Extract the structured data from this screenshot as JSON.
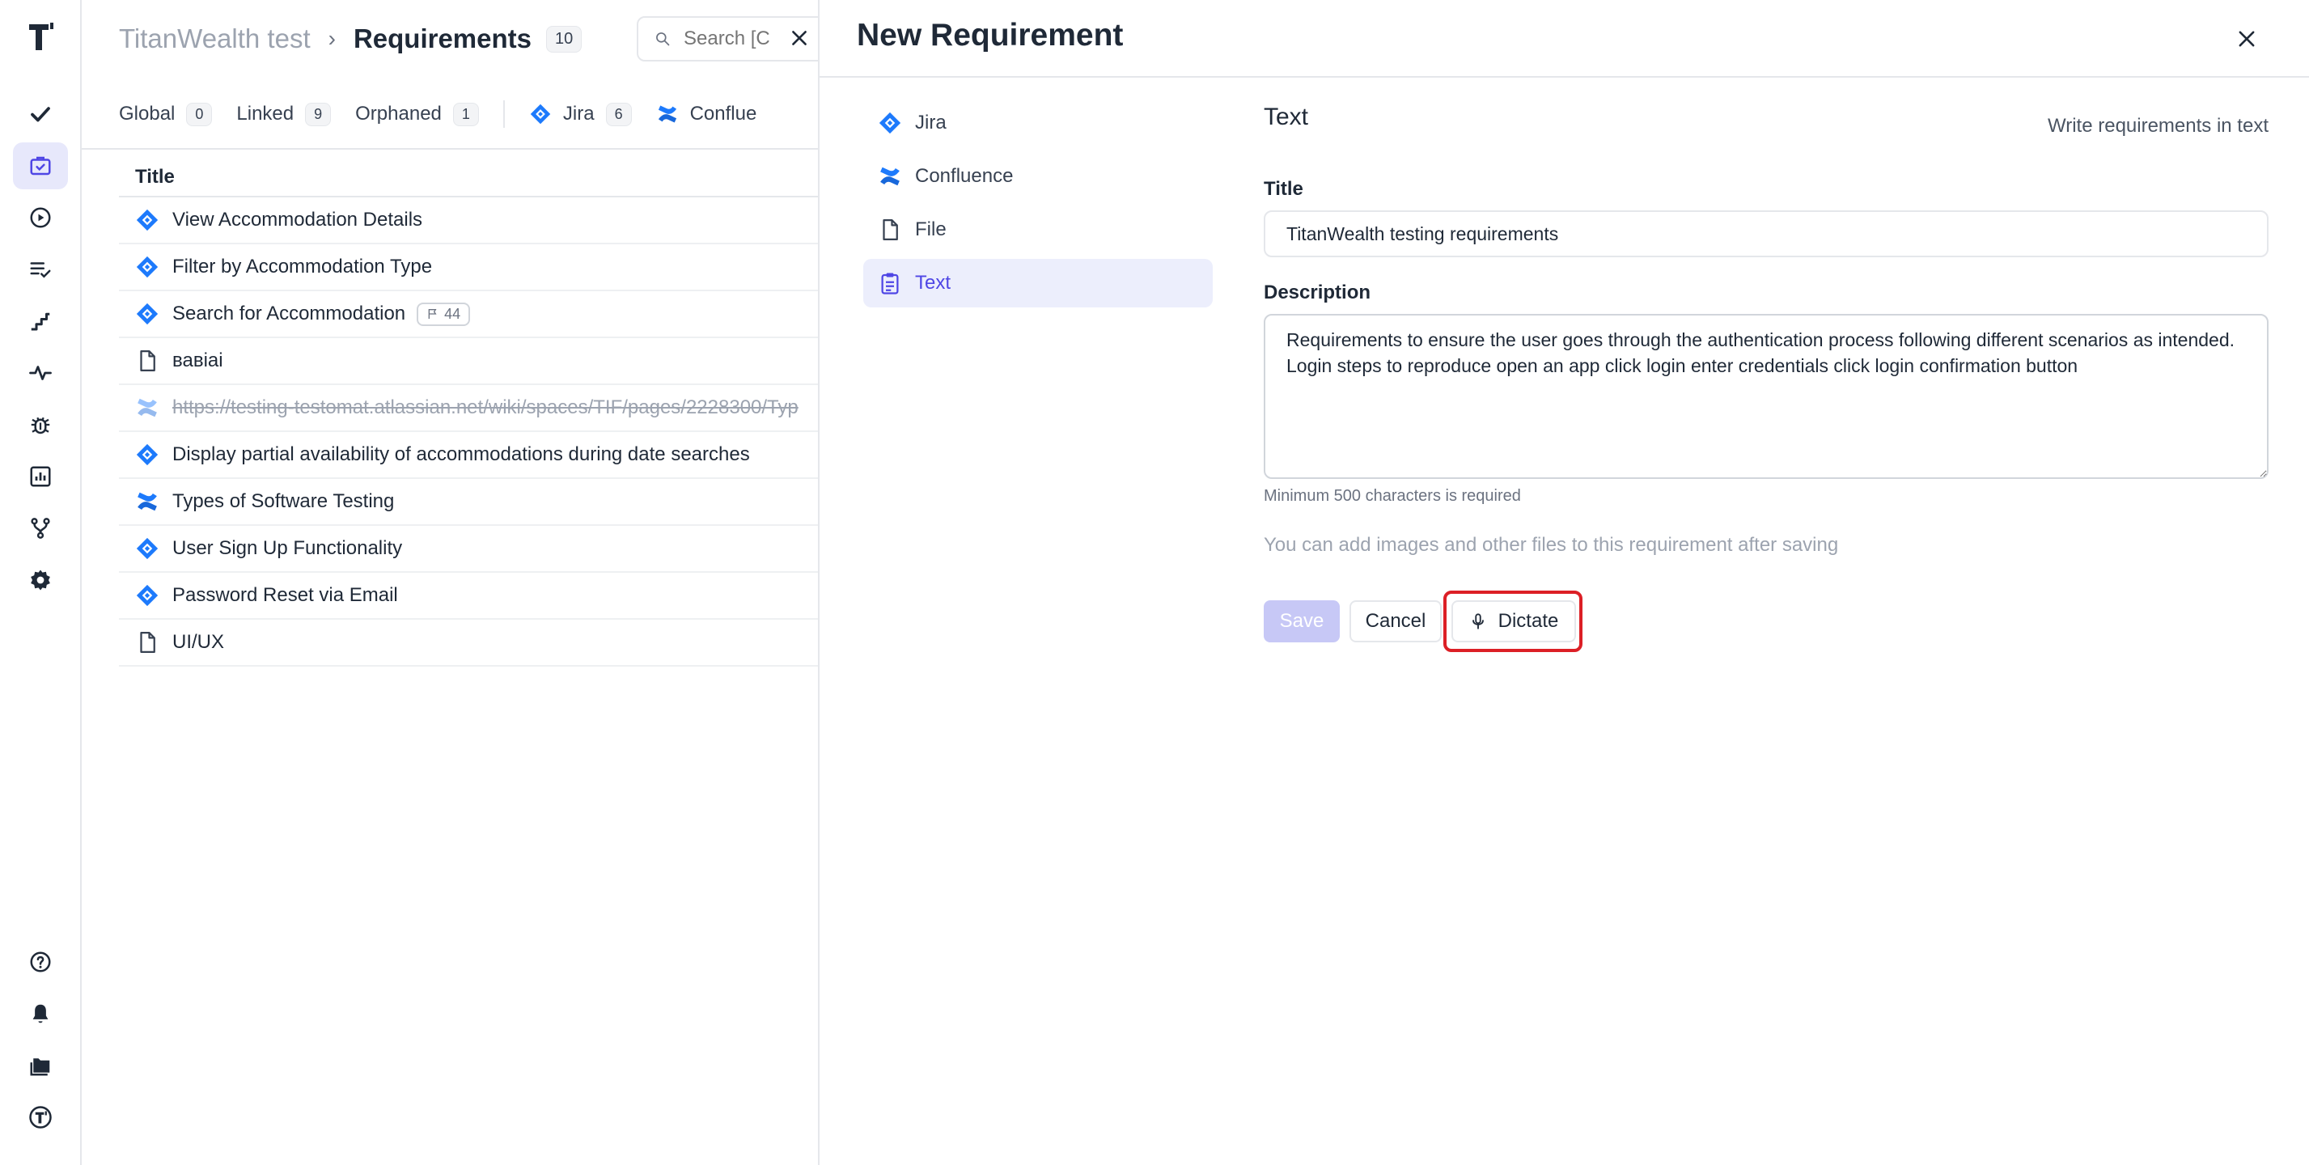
{
  "breadcrumb": {
    "project": "TitanWealth test",
    "separator": "›",
    "page": "Requirements",
    "count": "10"
  },
  "search": {
    "placeholder": "Search [C"
  },
  "filters": [
    {
      "label": "Global",
      "count": "0"
    },
    {
      "label": "Linked",
      "count": "9"
    },
    {
      "label": "Orphaned",
      "count": "1"
    },
    {
      "label": "Jira",
      "count": "6",
      "icon": "jira-icon"
    },
    {
      "label": "Conflue",
      "icon": "confluence-icon"
    }
  ],
  "list": {
    "column_title": "Title",
    "rows": [
      {
        "title": "View Accommodation Details",
        "icon": "jira-icon"
      },
      {
        "title": "Filter by Accommodation Type",
        "icon": "jira-icon"
      },
      {
        "title": "Search for Accommodation",
        "icon": "jira-icon",
        "badge": "44"
      },
      {
        "title": "вавіаі",
        "icon": "file-icon"
      },
      {
        "title": "https://testing-testomat.atlassian.net/wiki/spaces/TIF/pages/2228300/Typ",
        "icon": "confluence-icon",
        "orphaned": true
      },
      {
        "title": "Display partial availability of accommodations during date searches",
        "icon": "jira-icon"
      },
      {
        "title": "Types of Software Testing",
        "icon": "confluence-icon"
      },
      {
        "title": "User Sign Up Functionality",
        "icon": "jira-icon"
      },
      {
        "title": "Password Reset via Email",
        "icon": "jira-icon"
      },
      {
        "title": "UI/UX",
        "icon": "file-icon"
      }
    ]
  },
  "drawer": {
    "title": "New Requirement",
    "sources": [
      {
        "label": "Jira",
        "icon": "jira-icon"
      },
      {
        "label": "Confluence",
        "icon": "confluence-icon"
      },
      {
        "label": "File",
        "icon": "file-icon"
      },
      {
        "label": "Text",
        "icon": "clipboard-icon",
        "active": true
      }
    ],
    "form": {
      "heading": "Text",
      "hint": "Write requirements in text",
      "title_label": "Title",
      "title_value": "TitanWealth testing requirements",
      "description_label": "Description",
      "description_value": "Requirements to ensure the user goes through the authentication process following different scenarios as intended. Login steps to reproduce open an app click login enter credentials click login confirmation button",
      "min_note": "Minimum 500 characters is required",
      "files_note": "You can add images and other files to this requirement after saving",
      "save_label": "Save",
      "cancel_label": "Cancel",
      "dictate_label": "Dictate"
    }
  },
  "colors": {
    "accent": "#4f46e5",
    "jira": "#1d7afc",
    "highlight": "#dc1f26",
    "save_disabled": "#c7c8f6"
  }
}
